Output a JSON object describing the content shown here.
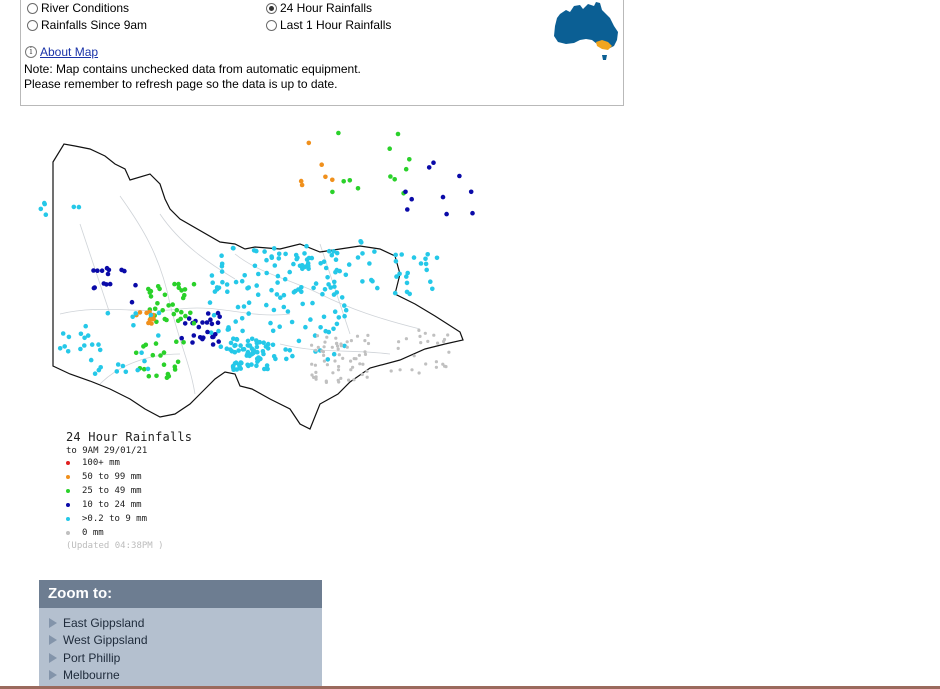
{
  "options": {
    "river_conditions": "River Conditions",
    "rainfalls_since_9am": "Rainfalls Since 9am",
    "hour24_rainfalls": "24 Hour Rainfalls",
    "last_1_hour": "Last 1 Hour Rainfalls",
    "selected": "24 Hour Rainfalls"
  },
  "about_link": "About Map",
  "note_line1": "Note: Map contains unchecked data from automatic equipment.",
  "note_line2": "Please remember to refresh page so the data is up to date.",
  "legend": {
    "title": "24 Hour Rainfalls",
    "subtitle": "to 9AM 29/01/21",
    "items": [
      {
        "label": "100+ mm",
        "color": "#e02020"
      },
      {
        "label": "50  to 99 mm",
        "color": "#f0901c"
      },
      {
        "label": "25  to 49 mm",
        "color": "#2ad12a"
      },
      {
        "label": "10  to 24 mm",
        "color": "#0a0aa8"
      },
      {
        "label": ">0.2 to 9 mm",
        "color": "#25c8e8"
      },
      {
        "label": "0 mm",
        "color": "#c0c0c0"
      }
    ],
    "updated": "(Updated 04:38PM  )"
  },
  "zoom": {
    "heading": "Zoom to:",
    "items": [
      "East Gippsland",
      "West Gippsland",
      "Port Phillip",
      "Melbourne"
    ]
  },
  "colors": {
    "australia_fill": "#0b5f94",
    "victoria_fill": "#f2a51e",
    "zoom_header": "#6d7d91",
    "zoom_body": "#b4c0cf",
    "link": "#1a33a8"
  }
}
